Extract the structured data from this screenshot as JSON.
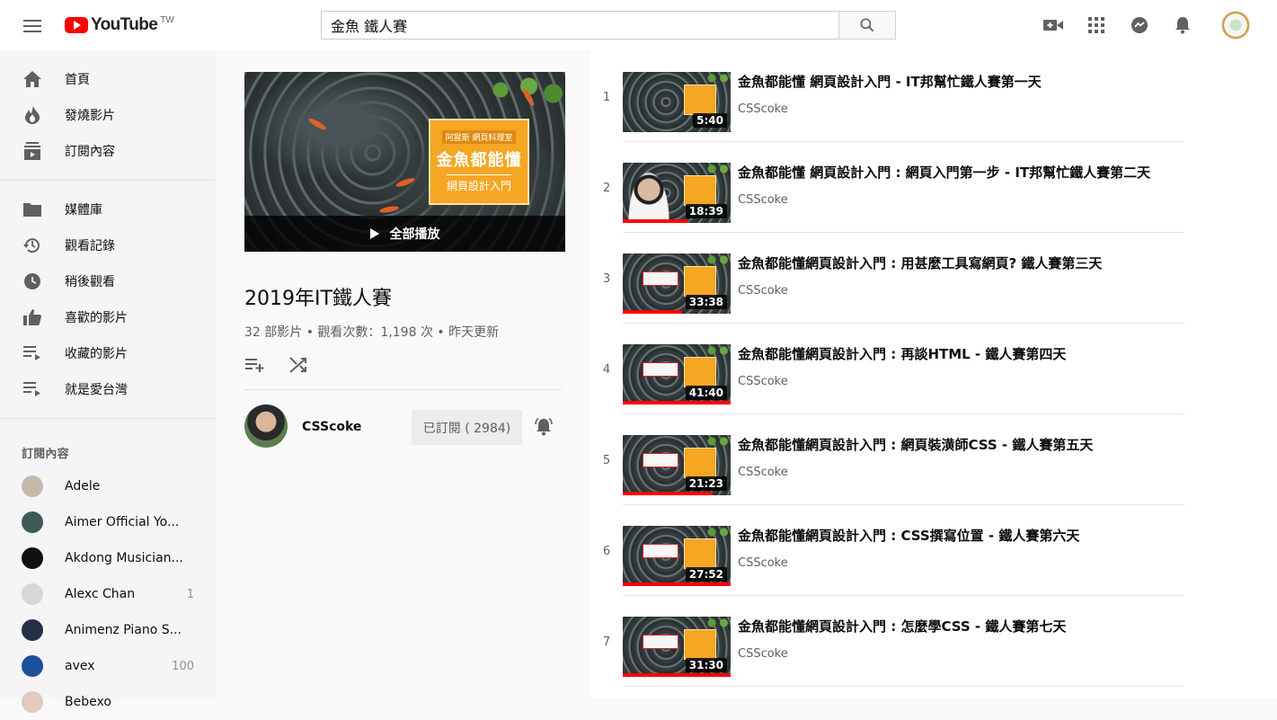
{
  "header": {
    "logo_text": "YouTube",
    "logo_region": "TW",
    "search_value": "金魚 鐵人賽",
    "icons": [
      "create-video-icon",
      "apps-icon",
      "messages-icon",
      "notifications-icon"
    ]
  },
  "sidebar": {
    "main": [
      {
        "label": "首頁",
        "icon": "home-icon"
      },
      {
        "label": "發燒影片",
        "icon": "trending-icon"
      },
      {
        "label": "訂閱內容",
        "icon": "subscriptions-icon"
      }
    ],
    "library": [
      {
        "label": "媒體庫",
        "icon": "library-icon"
      },
      {
        "label": "觀看記錄",
        "icon": "history-icon"
      },
      {
        "label": "稍後觀看",
        "icon": "watch-later-icon"
      },
      {
        "label": "喜歡的影片",
        "icon": "liked-icon"
      },
      {
        "label": "收藏的影片",
        "icon": "playlist-icon"
      },
      {
        "label": "就是愛台灣",
        "icon": "playlist-icon"
      }
    ],
    "subscriptions_heading": "訂閱內容",
    "subscriptions": [
      {
        "name": "Adele",
        "count": "",
        "color": "#c9b9ab"
      },
      {
        "name": "Aimer Official Yo...",
        "count": "",
        "color": "#3f5a56"
      },
      {
        "name": "Akdong Musician...",
        "count": "",
        "color": "#111111"
      },
      {
        "name": "Alexc Chan",
        "count": "1",
        "color": "#d7d7d7"
      },
      {
        "name": "Animenz Piano S...",
        "count": "",
        "color": "#24304a"
      },
      {
        "name": "avex",
        "count": "100",
        "color": "#1d4f9a"
      },
      {
        "name": "Bebexo",
        "count": "",
        "color": "#e3c9c0"
      }
    ]
  },
  "playlist": {
    "hero_badge_top": "阿猩斯 網頁料理室",
    "hero_badge_main": "金魚都能懂",
    "hero_badge_sub": "網頁設計入門",
    "play_all_label": "全部播放",
    "title": "2019年IT鐵人賽",
    "stats": "32 部影片 • 觀看次數：1,198 次 • 昨天更新",
    "owner_name": "CSScoke",
    "subscribe_label": "已訂閱 ( 2984)"
  },
  "videos": [
    {
      "index": "1",
      "title": "金魚都能懂 網頁設計入門 - IT邦幫忙鐵人賽第一天",
      "channel": "CSScoke",
      "duration": "5:40",
      "progress": 0,
      "style": "hero"
    },
    {
      "index": "2",
      "title": "金魚都能懂 網頁設計入門 : 網頁入門第一步 - IT邦幫忙鐵人賽第二天",
      "channel": "CSScoke",
      "duration": "18:39",
      "progress": 0.6,
      "style": "person"
    },
    {
      "index": "3",
      "title": "金魚都能懂網頁設計入門 : 用甚麼工具寫網頁? 鐵人賽第三天",
      "channel": "CSScoke",
      "duration": "33:38",
      "progress": 0.55,
      "style": "banner"
    },
    {
      "index": "4",
      "title": "金魚都能懂網頁設計入門 : 再談HTML - 鐵人賽第四天",
      "channel": "CSScoke",
      "duration": "41:40",
      "progress": 1.0,
      "style": "banner"
    },
    {
      "index": "5",
      "title": "金魚都能懂網頁設計入門 : 網頁裝潢師CSS - 鐵人賽第五天",
      "channel": "CSScoke",
      "duration": "21:23",
      "progress": 0.83,
      "style": "banner"
    },
    {
      "index": "6",
      "title": "金魚都能懂網頁設計入門 : CSS撰寫位置 - 鐵人賽第六天",
      "channel": "CSScoke",
      "duration": "27:52",
      "progress": 1.0,
      "style": "banner"
    },
    {
      "index": "7",
      "title": "金魚都能懂網頁設計入門 : 怎麼學CSS - 鐵人賽第七天",
      "channel": "CSScoke",
      "duration": "31:30",
      "progress": 1.0,
      "style": "banner"
    }
  ],
  "colors": {
    "accent": "#ff0000",
    "badge": "#f5a623"
  }
}
